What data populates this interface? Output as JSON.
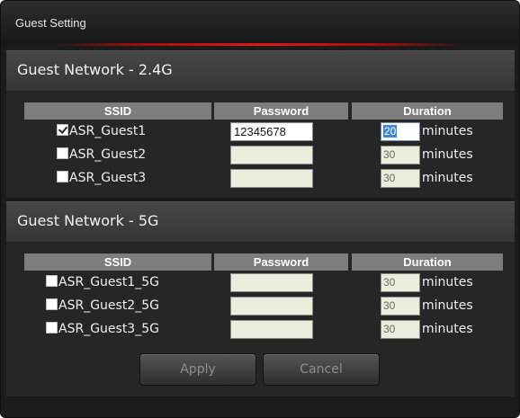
{
  "dialog": {
    "title": "Guest Setting"
  },
  "networks": [
    {
      "title": "Guest Network - 2.4G",
      "columns": {
        "ssid": "SSID",
        "password": "Password",
        "duration": "Duration"
      },
      "rows": [
        {
          "ssid": "ASR_Guest1",
          "checked": true,
          "password": "12345678",
          "duration": "20",
          "unit": "minutes"
        },
        {
          "ssid": "ASR_Guest2",
          "checked": false,
          "password": "",
          "duration": "30",
          "unit": "minutes"
        },
        {
          "ssid": "ASR_Guest3",
          "checked": false,
          "password": "",
          "duration": "30",
          "unit": "minutes"
        }
      ]
    },
    {
      "title": "Guest Network - 5G",
      "columns": {
        "ssid": "SSID",
        "password": "Password",
        "duration": "Duration"
      },
      "rows": [
        {
          "ssid": "ASR_Guest1_5G",
          "checked": false,
          "password": "",
          "duration": "30",
          "unit": "minutes"
        },
        {
          "ssid": "ASR_Guest2_5G",
          "checked": false,
          "password": "",
          "duration": "30",
          "unit": "minutes"
        },
        {
          "ssid": "ASR_Guest3_5G",
          "checked": false,
          "password": "",
          "duration": "30",
          "unit": "minutes"
        }
      ]
    }
  ],
  "buttons": {
    "apply": "Apply",
    "cancel": "Cancel"
  }
}
